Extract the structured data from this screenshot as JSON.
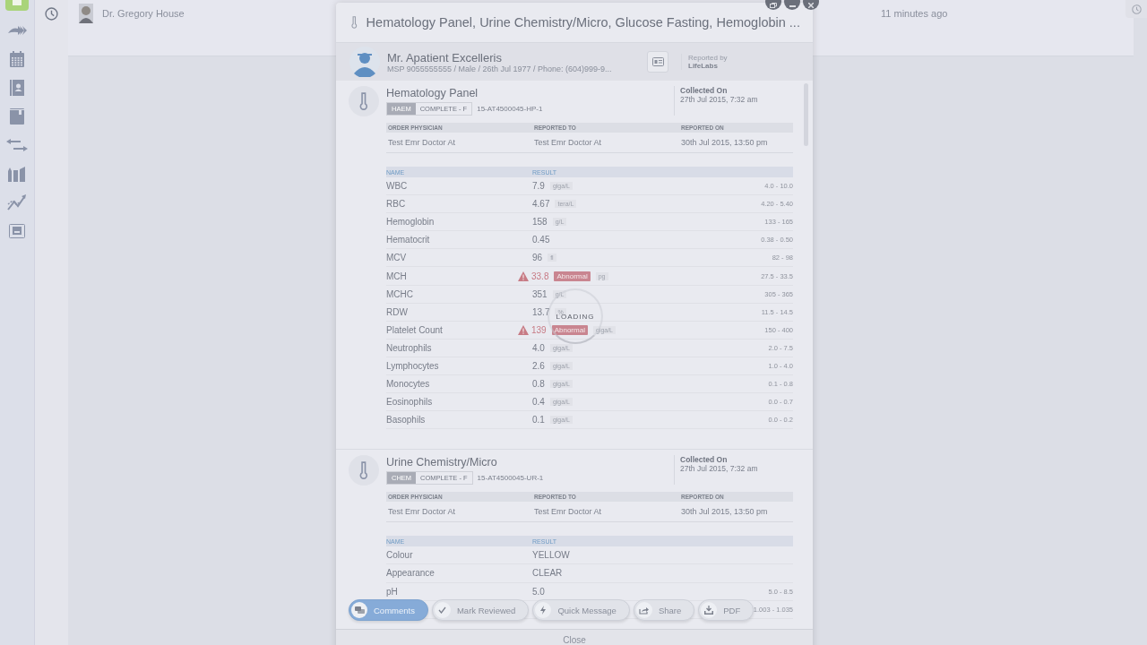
{
  "sidebar": {
    "items": [
      {
        "selected": true
      },
      {
        "selected": false
      },
      {
        "selected": false
      },
      {
        "selected": false
      },
      {
        "selected": false
      },
      {
        "selected": false
      },
      {
        "selected": false
      },
      {
        "selected": false
      },
      {
        "selected": false
      }
    ]
  },
  "notification": {
    "author": "Dr. Gregory House",
    "time": "11 minutes ago"
  },
  "modal": {
    "title": "Hematology Panel, Urine Chemistry/Micro, Glucose Fasting, Hemoglobin ...",
    "patient": {
      "name": "Mr. Apatient Excelleris",
      "details": "MSP 9055555555 / Male / 26th Jul 1977 / Phone: (604)999-9...",
      "reported_by_label": "Reported by",
      "reported_by": "LifeLabs"
    },
    "reports": [
      {
        "title": "Hematology Panel",
        "category": "HAEM",
        "status": "COMPLETE - F",
        "accession": "15-AT4500045-HP-1",
        "collected_label": "Collected On",
        "collected": "27th Jul 2015, 7:32 am",
        "meta_columns": [
          "ORDER PHYSICIAN",
          "REPORTED TO",
          "REPORTED ON"
        ],
        "meta_values": [
          "Test Emr Doctor At",
          "Test Emr Doctor At",
          "30th Jul 2015, 13:50 pm"
        ],
        "result_columns": [
          "NAME",
          "RESULT"
        ],
        "results": [
          {
            "name": "WBC",
            "value": "7.9",
            "unit": "giga/L",
            "range": "4.0 - 10.0",
            "abnormal": false
          },
          {
            "name": "RBC",
            "value": "4.67",
            "unit": "tera/L",
            "range": "4.20 - 5.40",
            "abnormal": false
          },
          {
            "name": "Hemoglobin",
            "value": "158",
            "unit": "g/L",
            "range": "133 - 165",
            "abnormal": false
          },
          {
            "name": "Hematocrit",
            "value": "0.45",
            "range": "0.38 - 0.50",
            "abnormal": false
          },
          {
            "name": "MCV",
            "value": "96",
            "unit": "fl",
            "range": "82 - 98",
            "abnormal": false
          },
          {
            "name": "MCH",
            "value": "33.8",
            "flag": "Abnormal",
            "unit": "pg",
            "range": "27.5 - 33.5",
            "abnormal": true
          },
          {
            "name": "MCHC",
            "value": "351",
            "unit": "g/L",
            "range": "305 - 365",
            "abnormal": false
          },
          {
            "name": "RDW",
            "value": "13.7",
            "unit": "%",
            "range": "11.5 - 14.5",
            "abnormal": false
          },
          {
            "name": "Platelet Count",
            "value": "139",
            "flag": "Abnormal",
            "unit": "giga/L",
            "range": "150 - 400",
            "abnormal": true
          },
          {
            "name": "Neutrophils",
            "value": "4.0",
            "unit": "giga/L",
            "range": "2.0 - 7.5",
            "abnormal": false
          },
          {
            "name": "Lymphocytes",
            "value": "2.6",
            "unit": "giga/L",
            "range": "1.0 - 4.0",
            "abnormal": false
          },
          {
            "name": "Monocytes",
            "value": "0.8",
            "unit": "giga/L",
            "range": "0.1 - 0.8",
            "abnormal": false
          },
          {
            "name": "Eosinophils",
            "value": "0.4",
            "unit": "giga/L",
            "range": "0.0 - 0.7",
            "abnormal": false
          },
          {
            "name": "Basophils",
            "value": "0.1",
            "unit": "giga/L",
            "range": "0.0 - 0.2",
            "abnormal": false
          }
        ]
      },
      {
        "title": "Urine Chemistry/Micro",
        "category": "CHEM",
        "status": "COMPLETE - F",
        "accession": "15-AT4500045-UR-1",
        "collected_label": "Collected On",
        "collected": "27th Jul 2015, 7:32 am",
        "meta_columns": [
          "ORDER PHYSICIAN",
          "REPORTED TO",
          "REPORTED ON"
        ],
        "meta_values": [
          "Test Emr Doctor At",
          "Test Emr Doctor At",
          "30th Jul 2015, 13:50 pm"
        ],
        "result_columns": [
          "NAME",
          "RESULT"
        ],
        "results": [
          {
            "name": "Colour",
            "value": "YELLOW",
            "abnormal": false
          },
          {
            "name": "Appearance",
            "value": "CLEAR",
            "abnormal": false
          },
          {
            "name": "pH",
            "value": "5.0",
            "range": "5.0 - 8.5",
            "abnormal": false
          },
          {
            "range": "1.003 - 1.035",
            "abnormal": false
          }
        ]
      }
    ],
    "loading": "LOADING",
    "actions": [
      {
        "kind": "comments",
        "label": "Comments",
        "selected": true
      },
      {
        "kind": "review",
        "label": "Mark Reviewed",
        "selected": false
      },
      {
        "kind": "message",
        "label": "Quick Message",
        "selected": false
      },
      {
        "kind": "share",
        "label": "Share",
        "selected": false
      },
      {
        "kind": "pdf",
        "label": "PDF",
        "selected": false
      }
    ],
    "close": "Close"
  }
}
